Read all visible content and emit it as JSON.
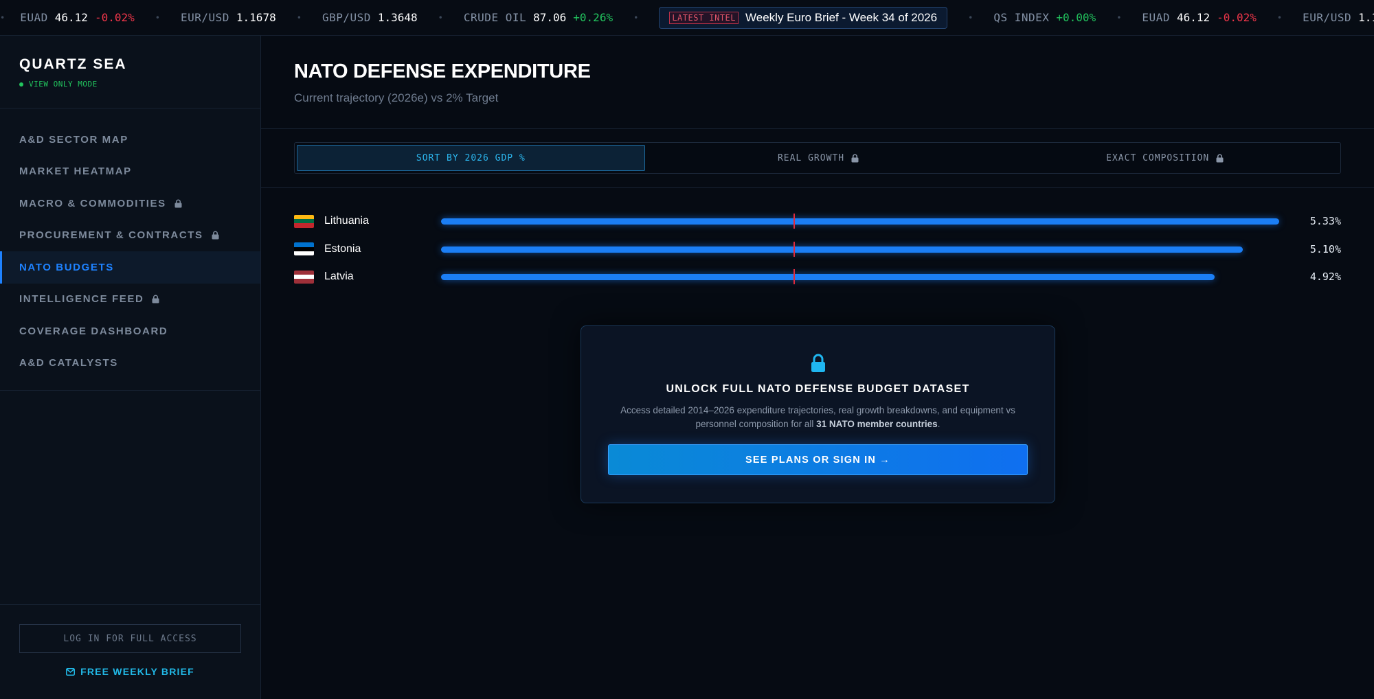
{
  "ticker": [
    {
      "symbol": "EUAD",
      "value": "46.12",
      "change": "-0.02%",
      "dir": "neg"
    },
    {
      "symbol": "EUR/USD",
      "value": "1.1678",
      "change": "",
      "dir": ""
    },
    {
      "symbol": "GBP/USD",
      "value": "1.3648",
      "change": "",
      "dir": ""
    },
    {
      "symbol": "CRUDE OIL",
      "value": "87.06",
      "change": "+0.26%",
      "dir": "pos"
    },
    {
      "intel": true,
      "badge": "LATEST INTEL",
      "text": "Weekly Euro Brief - Week 34 of 2026"
    },
    {
      "symbol": "QS INDEX",
      "value": "",
      "change": "+0.00%",
      "dir": "pos"
    },
    {
      "symbol": "EUAD",
      "value": "46.12",
      "change": "-0.02%",
      "dir": "neg"
    },
    {
      "symbol": "EUR/USD",
      "value": "1.1678",
      "change": "",
      "dir": ""
    }
  ],
  "brand": {
    "name": "QUARTZ SEA",
    "mode": "VIEW ONLY MODE"
  },
  "nav": [
    {
      "label": "A&D SECTOR MAP",
      "locked": false,
      "active": false,
      "key": "sector-map"
    },
    {
      "label": "MARKET HEATMAP",
      "locked": false,
      "active": false,
      "key": "market-heatmap"
    },
    {
      "label": "MACRO & COMMODITIES",
      "locked": true,
      "active": false,
      "key": "macro-commodities"
    },
    {
      "label": "PROCUREMENT & CONTRACTS",
      "locked": true,
      "active": false,
      "key": "procurement-contracts"
    },
    {
      "label": "NATO BUDGETS",
      "locked": false,
      "active": true,
      "key": "nato-budgets"
    },
    {
      "label": "INTELLIGENCE FEED",
      "locked": true,
      "active": false,
      "key": "intelligence-feed"
    },
    {
      "label": "COVERAGE DASHBOARD",
      "locked": false,
      "active": false,
      "key": "coverage-dashboard"
    },
    {
      "label": "A&D CATALYSTS",
      "locked": false,
      "active": false,
      "key": "ad-catalysts"
    }
  ],
  "sidebar_footer": {
    "login_label": "LOG IN FOR FULL ACCESS",
    "brief_label": "FREE WEEKLY BRIEF"
  },
  "page": {
    "title": "NATO DEFENSE EXPENDITURE",
    "subtitle": "Current trajectory (2026e) vs 2% Target"
  },
  "tabs": [
    {
      "label": "SORT BY 2026 GDP %",
      "locked": false,
      "active": true
    },
    {
      "label": "REAL GROWTH",
      "locked": true,
      "active": false
    },
    {
      "label": "EXACT COMPOSITION",
      "locked": true,
      "active": false
    }
  ],
  "chart_data": {
    "type": "bar",
    "categories": [
      "Lithuania",
      "Estonia",
      "Latvia"
    ],
    "values": [
      5.33,
      5.1,
      4.92
    ],
    "value_labels": [
      "5.33%",
      "5.10%",
      "4.92%"
    ],
    "target": 2,
    "xlim": [
      0,
      5.33
    ],
    "flags": [
      [
        "#fdb913",
        "#006a44",
        "#c1272d"
      ],
      [
        "#0072ce",
        "#000000",
        "#ffffff"
      ],
      [
        "#9e3039",
        "#ffffff",
        "#9e3039"
      ]
    ],
    "colors": {
      "bar": "#1b7ef5",
      "target": "#e02a3c"
    }
  },
  "unlock": {
    "title": "UNLOCK FULL NATO DEFENSE BUDGET DATASET",
    "desc_pre": "Access detailed 2014–2026 expenditure trajectories, real growth breakdowns, and equipment vs personnel composition for all ",
    "desc_bold": "31 NATO member countries",
    "desc_post": ".",
    "cta": "SEE PLANS OR SIGN IN →"
  }
}
